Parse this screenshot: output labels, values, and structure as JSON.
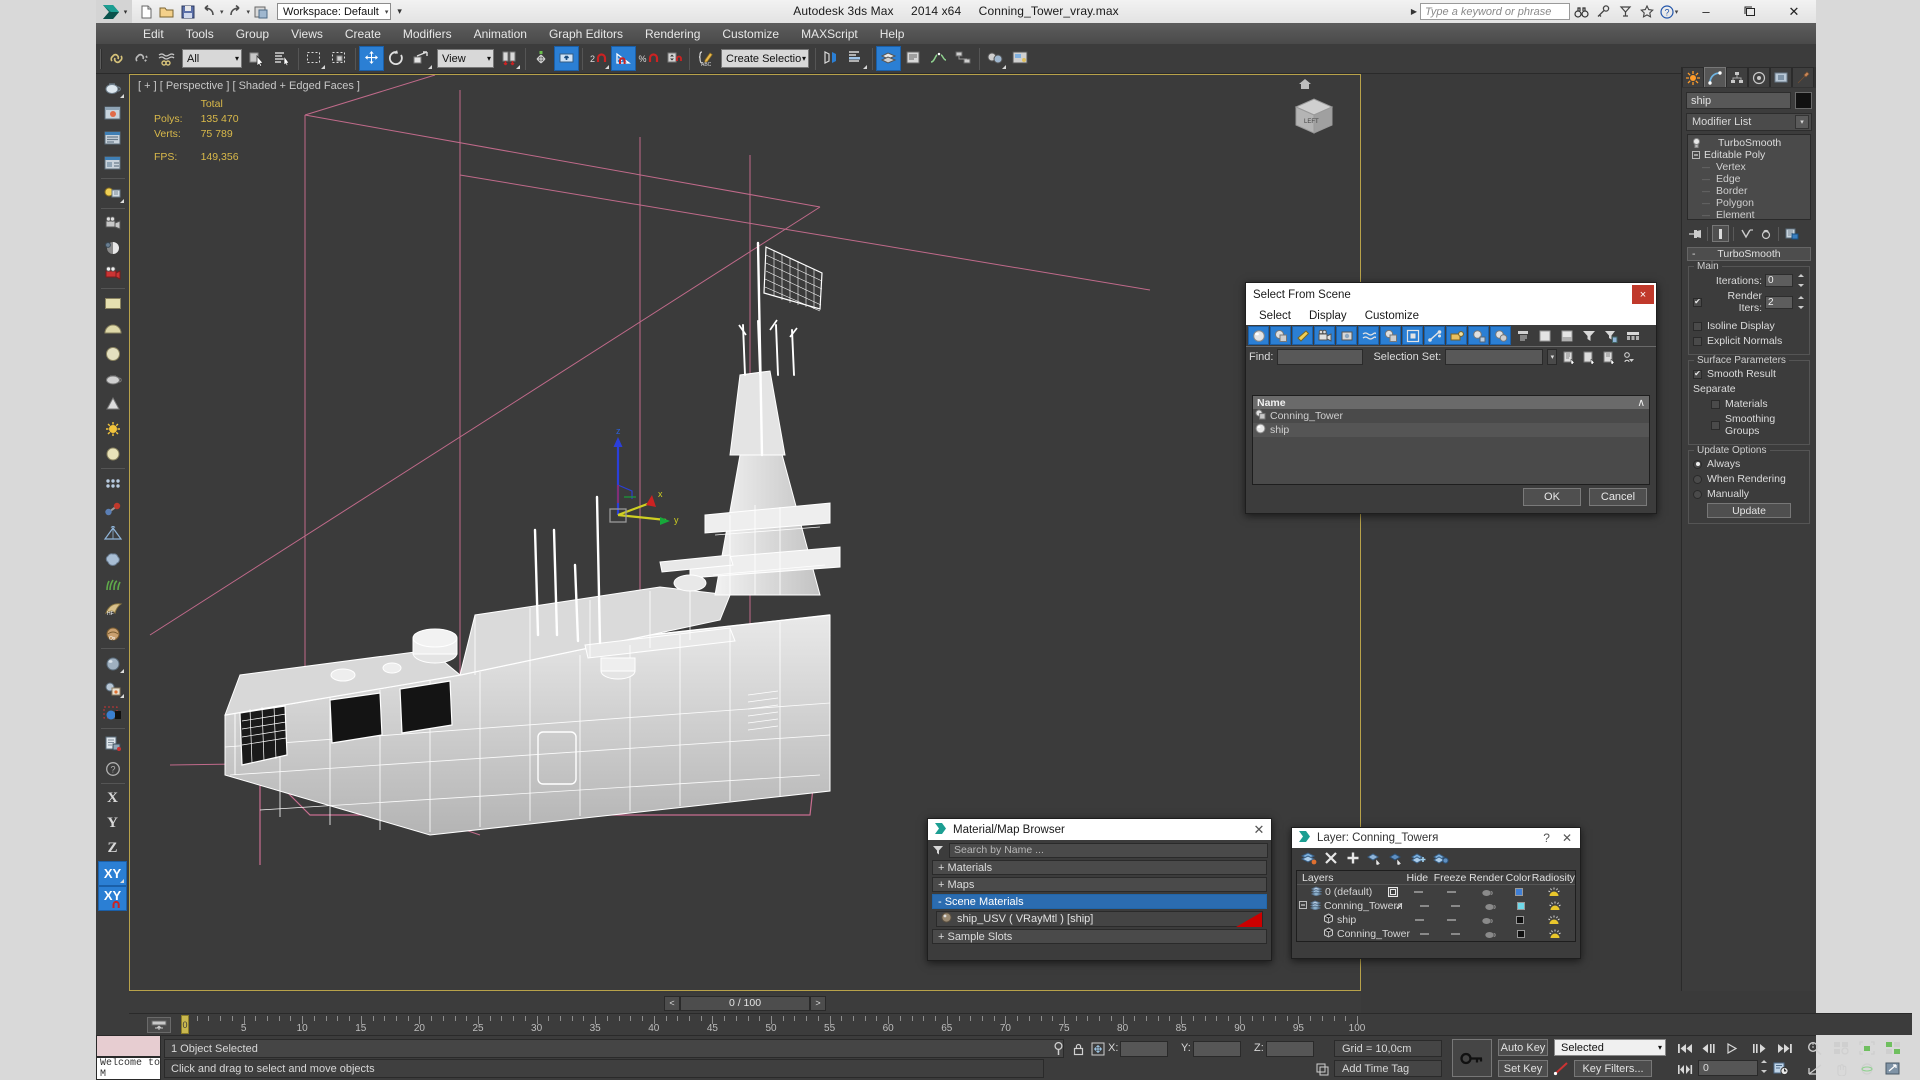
{
  "titlebar": {
    "app_title": "Autodesk 3ds Max",
    "version": "2014 x64",
    "filename": "Conning_Tower_vray.max",
    "workspace": "Workspace: Default",
    "search_placeholder": "Type a keyword or phrase",
    "minimize": "–",
    "maximize": "❐",
    "close": "✕"
  },
  "menubar": {
    "items": [
      "Edit",
      "Tools",
      "Group",
      "Views",
      "Create",
      "Modifiers",
      "Animation",
      "Graph Editors",
      "Rendering",
      "Customize",
      "MAXScript",
      "Help"
    ]
  },
  "toolbar": {
    "selection_filter": "All",
    "reference_coord": "View",
    "named_selection_set": "Create Selection Se",
    "snap_label_2": "2",
    "snap_label_pct": "%"
  },
  "viewport": {
    "label": "[ + ] [ Perspective ] [ Shaded + Edged Faces ]",
    "stats_header": "Total",
    "stats": [
      {
        "name": "Polys:",
        "value": "135 470"
      },
      {
        "name": "Verts:",
        "value": "75 789"
      }
    ],
    "fps_label": "FPS:",
    "fps_value": "149,356",
    "axis_x": "x",
    "axis_y": "y",
    "axis_z": "z"
  },
  "command_panel": {
    "object_name": "ship",
    "modifier_list": "Modifier List",
    "stack": [
      {
        "label": "TurboSmooth",
        "type": "modifier"
      },
      {
        "label": "Editable Poly",
        "type": "base"
      },
      {
        "label": "Vertex",
        "type": "sub"
      },
      {
        "label": "Edge",
        "type": "sub"
      },
      {
        "label": "Border",
        "type": "sub"
      },
      {
        "label": "Polygon",
        "type": "sub"
      },
      {
        "label": "Element",
        "type": "sub"
      }
    ],
    "rollout_title": "TurboSmooth",
    "rollout_minus": "-",
    "groups": {
      "main": {
        "label": "Main",
        "iterations_label": "Iterations:",
        "iterations_value": "0",
        "render_iters_label": "Render Iters:",
        "render_iters_value": "2",
        "render_iters_checked": true,
        "isoline_label": "Isoline Display",
        "isoline_checked": false,
        "explicit_normals_label": "Explicit Normals",
        "explicit_normals_checked": false
      },
      "surface": {
        "label": "Surface Parameters",
        "smooth_result_label": "Smooth Result",
        "smooth_result_checked": true,
        "separate_label": "Separate",
        "materials_label": "Materials",
        "materials_checked": false,
        "smoothing_groups_label": "Smoothing Groups",
        "smoothing_groups_checked": false
      },
      "update": {
        "label": "Update Options",
        "always_label": "Always",
        "when_rendering_label": "When Rendering",
        "manually_label": "Manually",
        "selected": "Always",
        "update_button": "Update"
      }
    }
  },
  "select_from_scene": {
    "title": "Select From Scene",
    "close": "×",
    "menu": [
      "Select",
      "Display",
      "Customize"
    ],
    "find_label": "Find:",
    "find_value": "",
    "selection_set_label": "Selection Set:",
    "selection_set_value": "",
    "column_name": "Name",
    "sort_glyph": "∧",
    "rows": [
      {
        "name": "Conning_Tower",
        "icon": "group-icon"
      },
      {
        "name": "ship",
        "icon": "geometry-sphere-icon"
      }
    ],
    "ok": "OK",
    "cancel": "Cancel"
  },
  "material_browser": {
    "title": "Material/Map Browser",
    "close": "✕",
    "search_placeholder": "Search by Name ...",
    "groups": [
      {
        "label": "+ Materials",
        "selected": false
      },
      {
        "label": "+ Maps",
        "selected": false
      },
      {
        "label": "- Scene Materials",
        "selected": true
      },
      {
        "label": "+ Sample Slots",
        "selected": false
      }
    ],
    "material_entry": "ship_USV  ( VRayMtl )  [ship]",
    "material_swatch_color": "#cc0000"
  },
  "layer_manager": {
    "title": "Layer: Conning_Towerя",
    "help": "?",
    "close": "✕",
    "columns": [
      "Layers",
      "",
      "Hide",
      "Freeze",
      "Render",
      "Color",
      "Radiosity"
    ],
    "rows": [
      {
        "name": "0 (default)",
        "indent": 1,
        "current": "box",
        "color": "#3f7fd6",
        "type": "layer"
      },
      {
        "name": "Conning_Towerя",
        "indent": 0,
        "current": "check",
        "color": "#6fd8e8",
        "type": "layer"
      },
      {
        "name": "ship",
        "indent": 2,
        "current": "",
        "color": "#111111",
        "type": "object"
      },
      {
        "name": "Conning_Tower",
        "indent": 2,
        "current": "",
        "color": "#111111",
        "type": "object"
      }
    ]
  },
  "timeline": {
    "prev": "<",
    "next": ">",
    "current": "0 / 100",
    "tick_labels": [
      "0",
      "5",
      "10",
      "15",
      "20",
      "25",
      "30",
      "35",
      "40",
      "45",
      "50",
      "55",
      "60",
      "65",
      "70",
      "75",
      "80",
      "85",
      "90",
      "95",
      "100"
    ],
    "handle_label": "0"
  },
  "statusbar": {
    "listener_text": "Welcome to M",
    "objects_selected": "1 Object Selected",
    "prompt": "Click and drag to select and move objects",
    "coord_x_label": "X:",
    "coord_y_label": "Y:",
    "coord_z_label": "Z:",
    "coord_x": "",
    "coord_y": "",
    "coord_z": "",
    "grid": "Grid = 10,0cm",
    "add_time_tag": "Add Time Tag",
    "auto_key": "Auto Key",
    "set_key": "Set Key",
    "key_mode": "Selected",
    "key_filters": "Key Filters...",
    "frame_field": "0"
  },
  "left_toolbar": {
    "axis_x": "X",
    "axis_y": "Y",
    "axis_z": "Z",
    "axis_xy": "XY",
    "axis_xy_snap": "XY"
  },
  "colors": {
    "accent_blue": "#2b7fd4",
    "panel_bg": "#3c3c3c",
    "viewport_bg": "#3b3b3b",
    "viewport_border": "#b8a24a",
    "stats_yellow": "#d9b94a",
    "grid_pink": "#c86d8f"
  }
}
